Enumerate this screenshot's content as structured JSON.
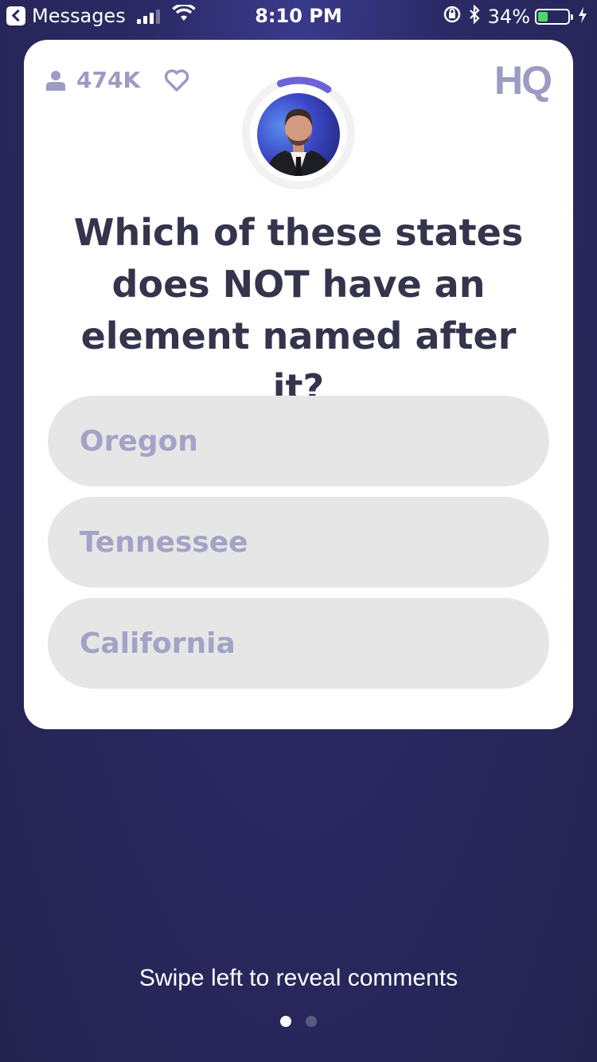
{
  "status_bar": {
    "back_app_label": "Messages",
    "time": "8:10 PM",
    "battery_percent": "34%",
    "battery_level": 0.34,
    "battery_color": "#4cd964"
  },
  "viewers": {
    "count": "474K"
  },
  "brand": {
    "logo_text": "HQ",
    "color": "#9b9bc4"
  },
  "timer": {
    "remaining_fraction": 0.15,
    "color": "#6b64d8"
  },
  "question": {
    "text": "Which of these states does NOT have an element named after it?"
  },
  "answers": [
    {
      "label": "Oregon"
    },
    {
      "label": "Tennessee"
    },
    {
      "label": "California"
    }
  ],
  "footer": {
    "hint": "Swipe left to reveal comments"
  },
  "pager": {
    "pages": 2,
    "current": 1
  }
}
